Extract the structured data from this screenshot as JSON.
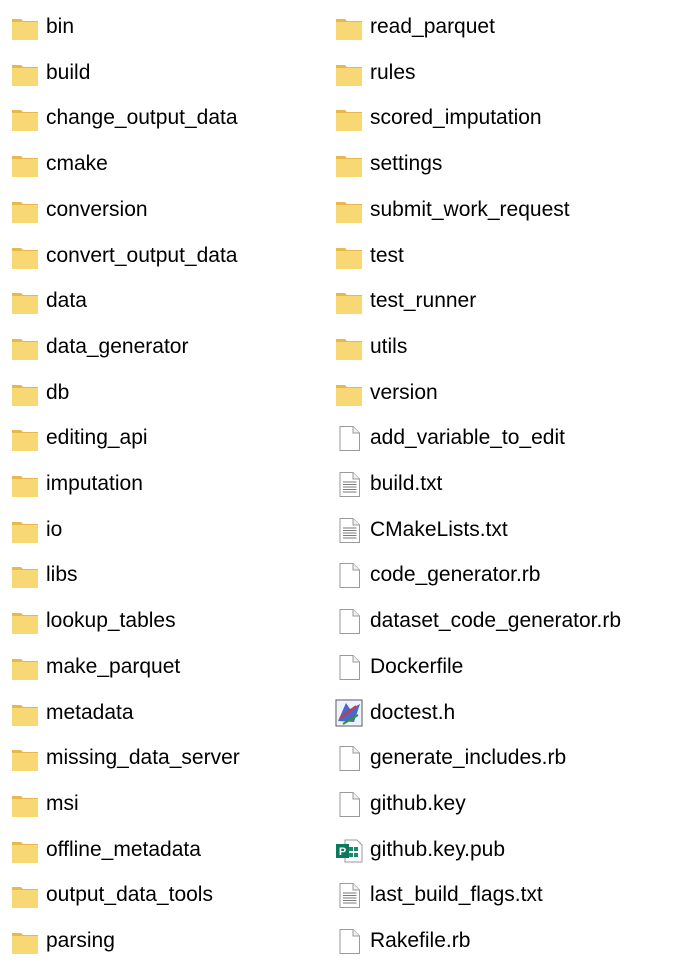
{
  "left_column": [
    {
      "name": "bin",
      "kind": "folder"
    },
    {
      "name": "build",
      "kind": "folder"
    },
    {
      "name": "change_output_data",
      "kind": "folder"
    },
    {
      "name": "cmake",
      "kind": "folder"
    },
    {
      "name": "conversion",
      "kind": "folder"
    },
    {
      "name": "convert_output_data",
      "kind": "folder"
    },
    {
      "name": "data",
      "kind": "folder"
    },
    {
      "name": "data_generator",
      "kind": "folder"
    },
    {
      "name": "db",
      "kind": "folder"
    },
    {
      "name": "editing_api",
      "kind": "folder"
    },
    {
      "name": "imputation",
      "kind": "folder"
    },
    {
      "name": "io",
      "kind": "folder"
    },
    {
      "name": "libs",
      "kind": "folder"
    },
    {
      "name": "lookup_tables",
      "kind": "folder"
    },
    {
      "name": "make_parquet",
      "kind": "folder"
    },
    {
      "name": "metadata",
      "kind": "folder"
    },
    {
      "name": "missing_data_server",
      "kind": "folder"
    },
    {
      "name": "msi",
      "kind": "folder"
    },
    {
      "name": "offline_metadata",
      "kind": "folder"
    },
    {
      "name": "output_data_tools",
      "kind": "folder"
    },
    {
      "name": "parsing",
      "kind": "folder"
    }
  ],
  "right_column": [
    {
      "name": "read_parquet",
      "kind": "folder"
    },
    {
      "name": "rules",
      "kind": "folder"
    },
    {
      "name": "scored_imputation",
      "kind": "folder"
    },
    {
      "name": "settings",
      "kind": "folder"
    },
    {
      "name": "submit_work_request",
      "kind": "folder"
    },
    {
      "name": "test",
      "kind": "folder"
    },
    {
      "name": "test_runner",
      "kind": "folder"
    },
    {
      "name": "utils",
      "kind": "folder"
    },
    {
      "name": "version",
      "kind": "folder"
    },
    {
      "name": "add_variable_to_edit",
      "kind": "file-blank"
    },
    {
      "name": "build.txt",
      "kind": "file-text"
    },
    {
      "name": "CMakeLists.txt",
      "kind": "file-text"
    },
    {
      "name": "code_generator.rb",
      "kind": "file-blank"
    },
    {
      "name": "dataset_code_generator.rb",
      "kind": "file-blank"
    },
    {
      "name": "Dockerfile",
      "kind": "file-blank"
    },
    {
      "name": "doctest.h",
      "kind": "file-cpp-header"
    },
    {
      "name": "generate_includes.rb",
      "kind": "file-blank"
    },
    {
      "name": "github.key",
      "kind": "file-blank"
    },
    {
      "name": "github.key.pub",
      "kind": "file-publisher"
    },
    {
      "name": "last_build_flags.txt",
      "kind": "file-text"
    },
    {
      "name": "Rakefile.rb",
      "kind": "file-blank"
    }
  ],
  "icons": {
    "folder": "folder-icon",
    "file-blank": "file-icon",
    "file-text": "text-file-icon",
    "file-cpp-header": "cpp-header-file-icon",
    "file-publisher": "publisher-file-icon"
  },
  "colors": {
    "folder_body": "#F8D775",
    "folder_tab": "#E8B84A",
    "file_outline": "#9a9a9a"
  }
}
